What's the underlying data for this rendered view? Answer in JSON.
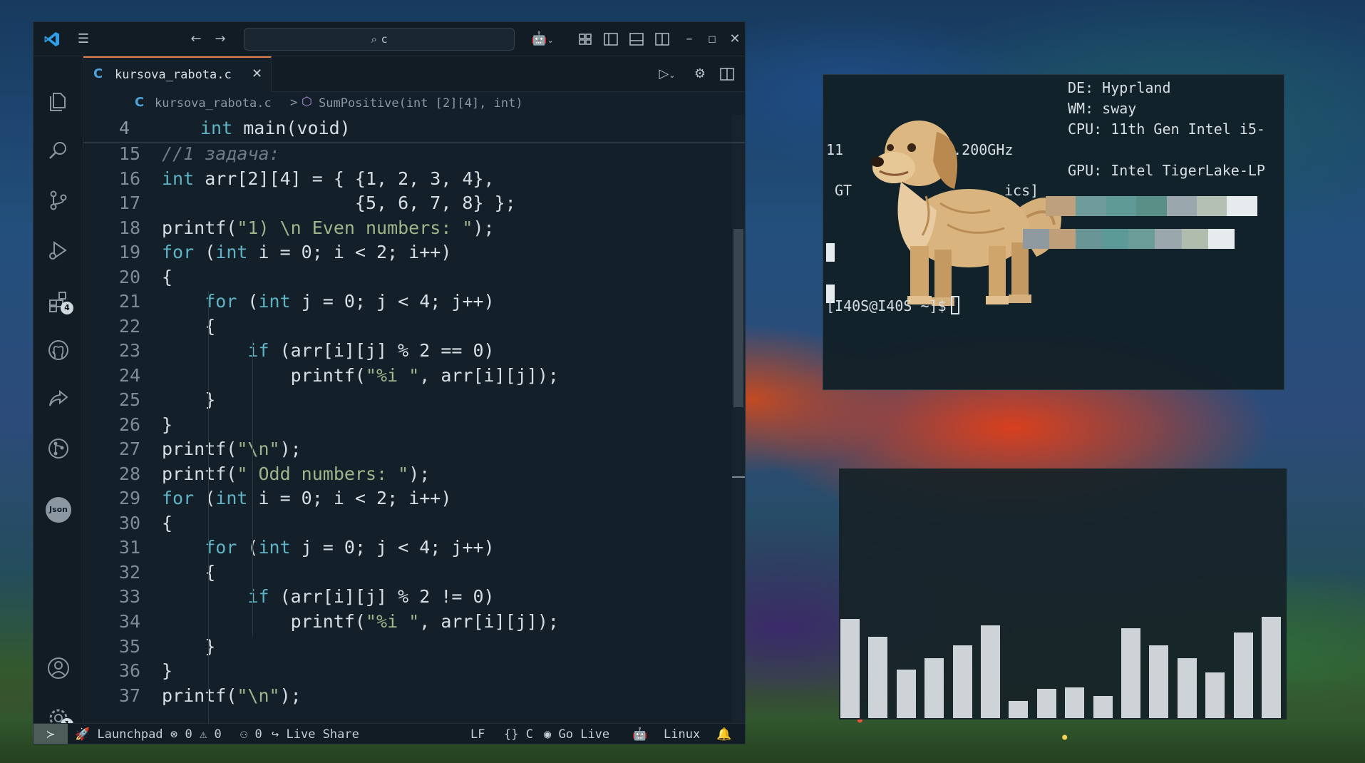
{
  "vscode": {
    "search_text": "c",
    "tab": {
      "icon": "C",
      "label": "kursova_rabota.c"
    },
    "breadcrumb": {
      "icon": "C",
      "file": "kursova_rabota.c",
      "separator": ">",
      "symbol": "SumPositive(int [2][4], int)"
    },
    "sticky": {
      "line": "4",
      "code": "int main(void)"
    },
    "lines": [
      {
        "n": "15",
        "code": "//1 задача:"
      },
      {
        "n": "16",
        "code": "int arr[2][4] = { {1, 2, 3, 4},"
      },
      {
        "n": "17",
        "code": "                  {5, 6, 7, 8} };"
      },
      {
        "n": "18",
        "code": "printf(\"1) \\n Even numbers: \");"
      },
      {
        "n": "19",
        "code": "for (int i = 0; i < 2; i++)"
      },
      {
        "n": "20",
        "code": "{"
      },
      {
        "n": "21",
        "code": "    for (int j = 0; j < 4; j++)"
      },
      {
        "n": "22",
        "code": "    {"
      },
      {
        "n": "23",
        "code": "        if (arr[i][j] % 2 == 0)"
      },
      {
        "n": "24",
        "code": "            printf(\"%i \", arr[i][j]);"
      },
      {
        "n": "25",
        "code": "    }"
      },
      {
        "n": "26",
        "code": "}"
      },
      {
        "n": "27",
        "code": "printf(\"\\n\");"
      },
      {
        "n": "28",
        "code": "printf(\" Odd numbers: \");"
      },
      {
        "n": "29",
        "code": "for (int i = 0; i < 2; i++)"
      },
      {
        "n": "30",
        "code": "{"
      },
      {
        "n": "31",
        "code": "    for (int j = 0; j < 4; j++)"
      },
      {
        "n": "32",
        "code": "    {"
      },
      {
        "n": "33",
        "code": "        if (arr[i][j] % 2 != 0)"
      },
      {
        "n": "34",
        "code": "            printf(\"%i \", arr[i][j]);"
      },
      {
        "n": "35",
        "code": "    }"
      },
      {
        "n": "36",
        "code": "}"
      },
      {
        "n": "37",
        "code": "printf(\"\\n\");"
      }
    ],
    "activity_badges": {
      "extensions": "4",
      "settings": "1"
    },
    "json_icon_label": "Json",
    "status": {
      "launchpad": "Launchpad",
      "errors": "0",
      "warnings": "0",
      "ports": "0",
      "live_share": "Live Share",
      "eol": "LF",
      "language": "C",
      "go_live": "Go Live",
      "platform": "Linux"
    }
  },
  "terminal": {
    "de": "DE: Hyprland",
    "wm": "WM: sway",
    "cpu": "CPU: 11th Gen Intel i5-",
    "gpu": "GPU: Intel TigerLake-LP",
    "frag_freq_prefix": "11",
    "frag_freq": "@ 4.200GHz",
    "frag_gt": "GT",
    "frag_ics": "ics]",
    "prompt": "[I40S@I40S ~]$",
    "swatches_row1": [
      "#bfa07e",
      "#6f9b9b",
      "#5f9a97",
      "#5a8f88",
      "#9aa7ac",
      "#b3c0b3",
      "#e6ebee"
    ],
    "swatches_row2": [
      "#8f9aa0",
      "#bf9f7a",
      "#6a9596",
      "#5b9a96",
      "#6c9c98",
      "#9aa8ad",
      "#b0bcae",
      "#e6ebee"
    ]
  },
  "visualizer": {
    "levels": [
      0.94,
      0.77,
      0.46,
      0.57,
      0.69,
      0.88,
      0.16,
      0.28,
      0.29,
      0.21,
      0.85,
      0.69,
      0.57,
      0.43,
      0.81,
      0.96
    ]
  },
  "colors": {
    "accent_tab": "#e57f4a",
    "c_icon": "#4ea2d8",
    "keyword": "#5fb3c4",
    "string": "#9fb58a",
    "bar": "#cdd3d6"
  }
}
